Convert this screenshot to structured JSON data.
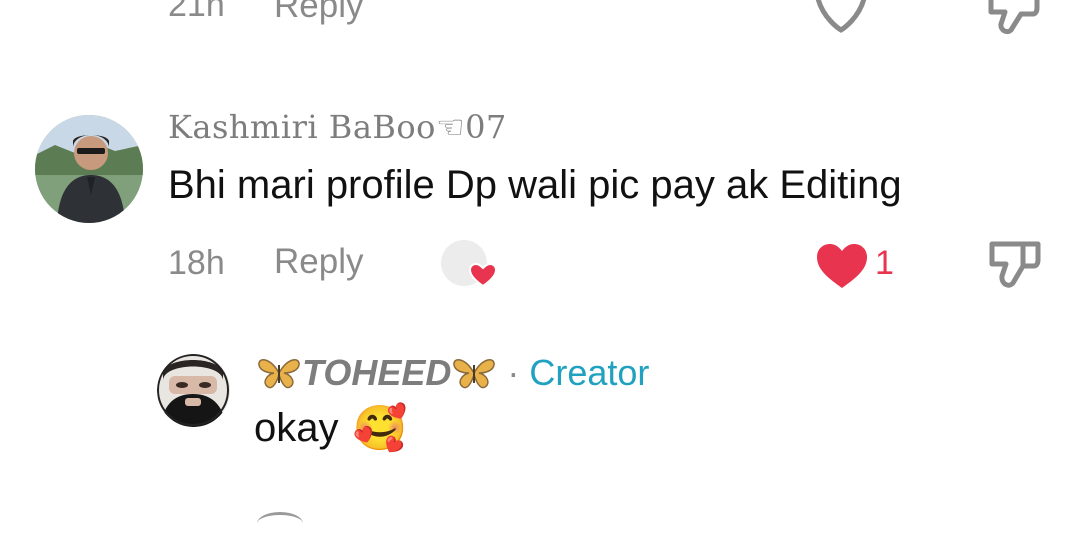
{
  "top_row": {
    "time": "21h",
    "reply_label": "Reply"
  },
  "comment": {
    "author": "Kashmiri BaBoo☜07",
    "text": "Bhi mari profile Dp wali pic pay ak Editing",
    "time": "18h",
    "reply_label": "Reply",
    "like_count": "1"
  },
  "reply_comment": {
    "author": "TOHEED",
    "separator": "·",
    "badge": "Creator",
    "text": "okay",
    "emoji": "🥰"
  },
  "icons": {
    "heart": "heart-icon",
    "dislike": "thumbs-down-icon",
    "creator_liked": "creator-liked-icon",
    "butterfly": "butterfly-icon"
  },
  "colors": {
    "like": "#e8344e",
    "creator": "#1fa1bf",
    "muted": "#8a8a8a"
  }
}
